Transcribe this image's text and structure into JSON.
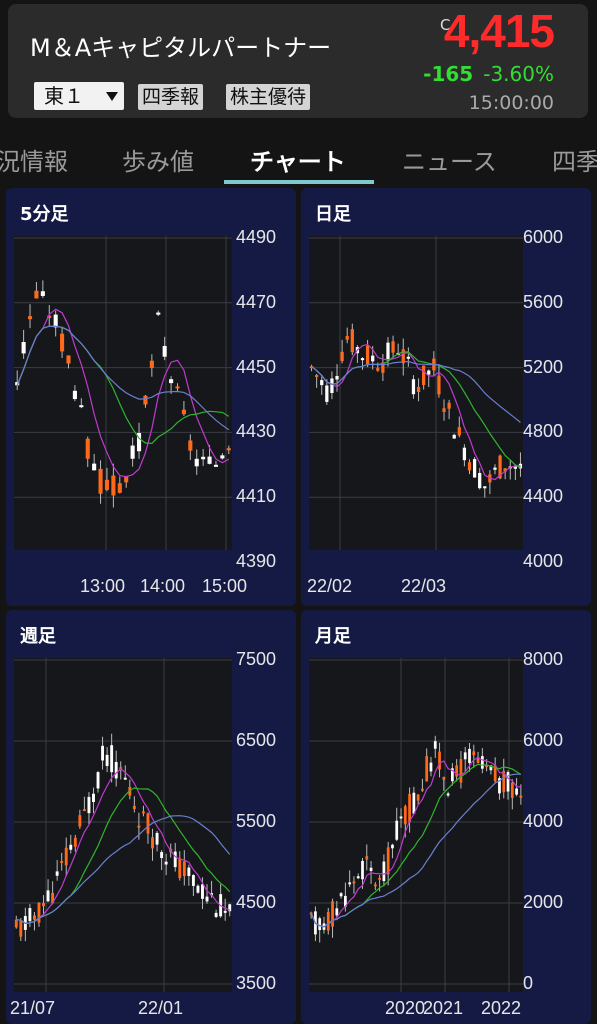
{
  "header": {
    "company_name": "M＆Aキャピタルパートナー",
    "market": "東１",
    "buttons": [
      "四季報",
      "株主優待"
    ],
    "price_marker": "C",
    "price": "4,415",
    "change": "-165",
    "change_pct": "-3.60%",
    "time": "15:00:00",
    "colors": {
      "price_down_red": "#ff2a2a",
      "change_green": "#33dd33"
    }
  },
  "tabs": [
    {
      "label": "況情報"
    },
    {
      "label": "歩み値"
    },
    {
      "label": "チャート",
      "active": true
    },
    {
      "label": "ニュース"
    },
    {
      "label": "四季"
    }
  ],
  "chart_data": [
    {
      "type": "candlestick",
      "title": "5分足",
      "y_ticks": [
        "4490",
        "4470",
        "4450",
        "4430",
        "4410",
        "4390"
      ],
      "x_ticks": [
        "13:00",
        "14:00",
        "15:00"
      ],
      "ylim": [
        4390,
        4490
      ]
    },
    {
      "type": "candlestick",
      "title": "日足",
      "y_ticks": [
        "6000",
        "5600",
        "5200",
        "4800",
        "4400",
        "4000"
      ],
      "x_ticks": [
        "22/02",
        "22/03"
      ],
      "ylim": [
        4000,
        6000
      ]
    },
    {
      "type": "candlestick",
      "title": "週足",
      "y_ticks": [
        "7500",
        "6500",
        "5500",
        "4500",
        "3500"
      ],
      "x_ticks": [
        "21/07",
        "22/01"
      ],
      "ylim": [
        3500,
        7500
      ]
    },
    {
      "type": "candlestick",
      "title": "月足",
      "y_ticks": [
        "8000",
        "6000",
        "4000",
        "2000",
        "0"
      ],
      "x_ticks": [
        "2020",
        "2021",
        "2022"
      ],
      "ylim": [
        0,
        8000
      ]
    }
  ],
  "chart_colors": {
    "up": "#ff6a1a",
    "down": "#ffffff",
    "ma_short": "#c03ad0",
    "ma_mid": "#2fb52f",
    "ma_long": "#6a7fd0"
  }
}
